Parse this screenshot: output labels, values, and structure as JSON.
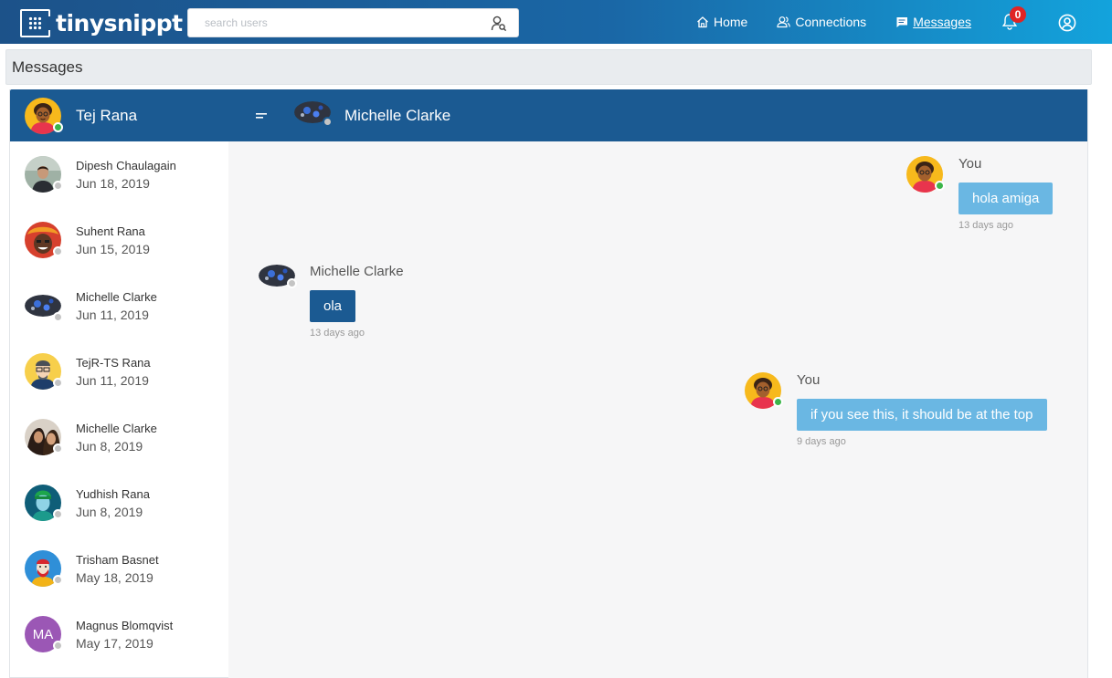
{
  "app": {
    "logo_text": "tinysnippt"
  },
  "search": {
    "placeholder": "search users",
    "value": ""
  },
  "nav": {
    "home": "Home",
    "connections": "Connections",
    "messages": "Messages",
    "notification_count": "0"
  },
  "page_title": "Messages",
  "current_user": {
    "name": "Tej Rana",
    "status": "online"
  },
  "contacts": [
    {
      "name": "Dipesh Chaulagain",
      "date": "Jun 18, 2019"
    },
    {
      "name": "Suhent Rana",
      "date": "Jun 15, 2019"
    },
    {
      "name": "Michelle Clarke",
      "date": "Jun 11, 2019"
    },
    {
      "name": "TejR-TS Rana",
      "date": "Jun 11, 2019"
    },
    {
      "name": "Michelle Clarke",
      "date": "Jun 8, 2019"
    },
    {
      "name": "Yudhish Rana",
      "date": "Jun 8, 2019"
    },
    {
      "name": "Trisham Basnet",
      "date": "May 18, 2019"
    },
    {
      "name": "Magnus Blomqvist",
      "date": "May 17, 2019",
      "initials": "MA"
    }
  ],
  "chat": {
    "partner_name": "Michelle Clarke",
    "messages": [
      {
        "sender": "You",
        "text": "hola amiga",
        "time": "13 days ago",
        "mine": true
      },
      {
        "sender": "Michelle Clarke",
        "text": "ola",
        "time": "13 days ago",
        "mine": false
      },
      {
        "sender": "You",
        "text": "if you see this, it should be at the top",
        "time": "9 days ago",
        "mine": true
      }
    ]
  },
  "colors": {
    "header": "#1b5a92",
    "my_bubble": "#6ab7e3",
    "their_bubble": "#1b5a92",
    "online": "#3bb54a",
    "offline": "#c4c4c4",
    "badge": "#e02424"
  }
}
